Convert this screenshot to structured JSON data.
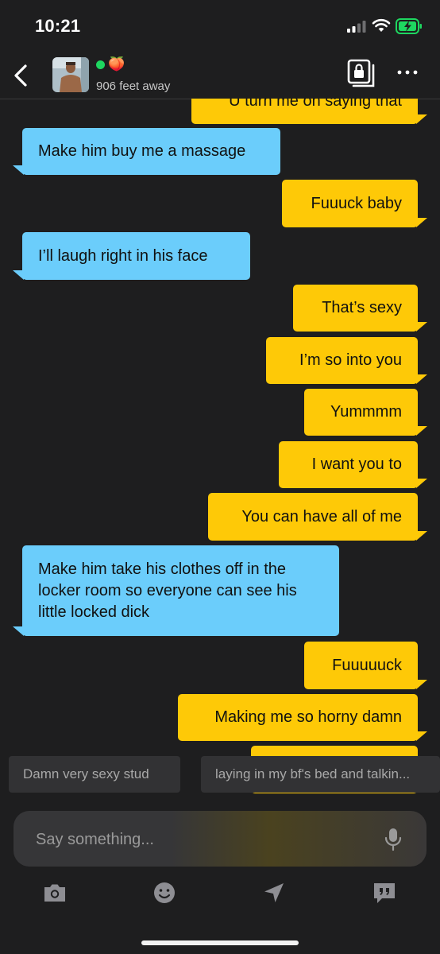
{
  "status_bar": {
    "time": "10:21"
  },
  "header": {
    "distance": "906 feet away",
    "peach_emoji": "🍑"
  },
  "icons": {
    "back": "chevron-left-icon",
    "album": "locked-album-icon",
    "more": "ellipsis-icon",
    "mic": "microphone-icon",
    "camera": "camera-icon",
    "emoji": "smiley-icon",
    "location": "location-arrow-icon",
    "phrases": "quote-bubble-icon"
  },
  "colors": {
    "background": "#1e1e1f",
    "outgoing_bubble": "#fec907",
    "incoming_bubble": "#6bcdfb",
    "online": "#1ed760"
  },
  "messages": [
    {
      "from": "me",
      "text": "U turn me on saying that"
    },
    {
      "from": "them",
      "text": "Make him buy me a massage"
    },
    {
      "from": "me",
      "text": "Fuuuck baby"
    },
    {
      "from": "them",
      "text": "I’ll laugh right in his face"
    },
    {
      "from": "me",
      "text": "That’s sexy"
    },
    {
      "from": "me",
      "text": "I’m so into you"
    },
    {
      "from": "me",
      "text": "Yummmm"
    },
    {
      "from": "me",
      "text": "I want you to"
    },
    {
      "from": "me",
      "text": "You can have all of me"
    },
    {
      "from": "them",
      "lines": [
        "Make him take his clothes off in the",
        "locker room so everyone can see his",
        "little locked dick"
      ]
    },
    {
      "from": "me",
      "text": "Fuuuuuck"
    },
    {
      "from": "me",
      "text": "Making me so horny damn"
    }
  ],
  "suggestions": [
    "Damn very sexy stud",
    "laying in my bf's bed and talkin..."
  ],
  "composer": {
    "placeholder": "Say something..."
  }
}
